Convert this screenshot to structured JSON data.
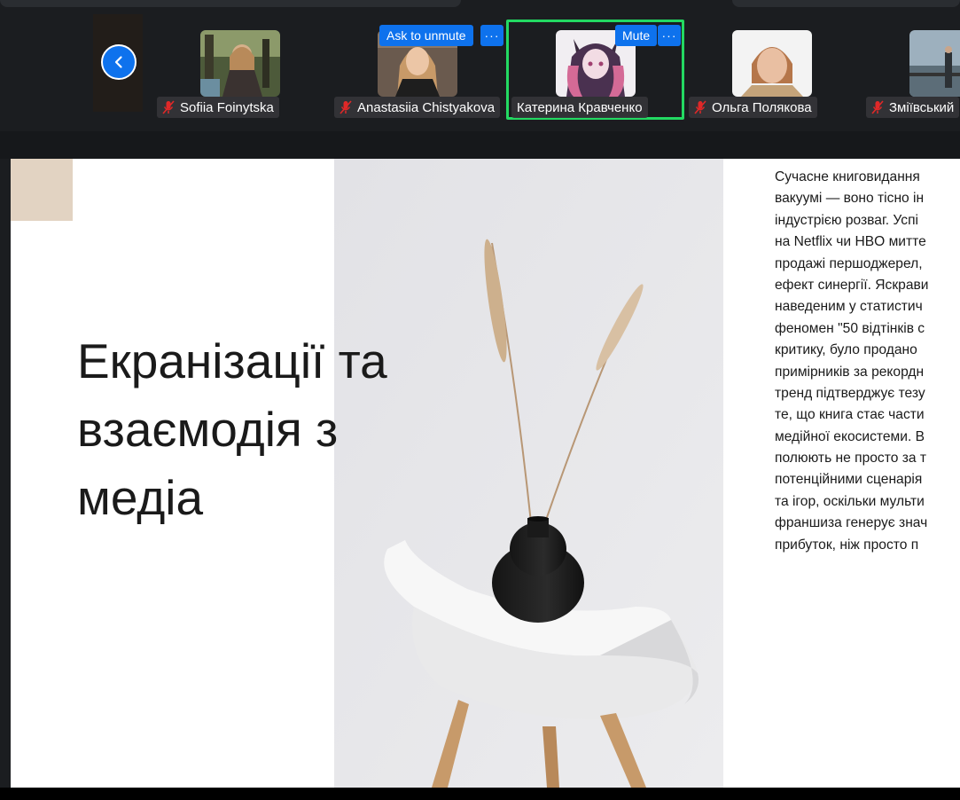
{
  "meeting": {
    "participants": [
      {
        "name": "Sofiia Foinytska",
        "muted": true
      },
      {
        "name": "Anastasiia Chistyakova",
        "muted": true,
        "action": "Ask to unmute",
        "more": "···"
      },
      {
        "name": "Катерина Кравченко",
        "muted": false,
        "action": "Mute",
        "more": "···",
        "active_speaker": true
      },
      {
        "name": "Ольга Полякова",
        "muted": true
      },
      {
        "name": "Зміївський",
        "muted": true
      }
    ],
    "colors": {
      "accent": "#0e72ed",
      "active_border": "#23d962",
      "muted_mic": "#e02828"
    }
  },
  "slide": {
    "title": "Екранізації та\nвзаємодія з\nмедіа",
    "body_lines": [
      "Сучасне книговидання",
      "вакуумі — воно тісно ін",
      "індустрією розваг. Успі",
      "на Netflix чи HBO митте",
      "продажі першоджерел,",
      "ефект синергії. Яскрави",
      "наведеним у статистич",
      "феномен \"50 відтінків с",
      "критику, було продано",
      "примірників за рекордн",
      "тренд підтверджує тезу",
      "те, що книга стає части",
      "медійної екосистеми. В",
      "полюють не просто за т",
      "потенційними сценарія",
      "та ігор, оскільки мульти",
      "франшиза генерує знач",
      "прибуток, ніж просто п"
    ]
  }
}
